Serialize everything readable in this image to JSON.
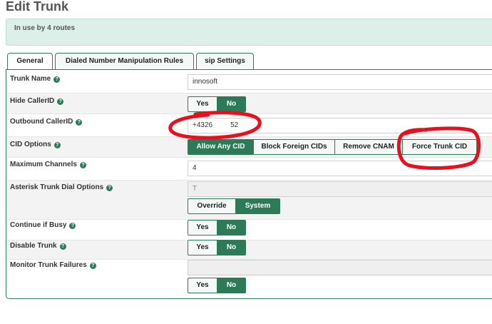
{
  "page_title": "Edit Trunk",
  "info_text": "In use by 4 routes",
  "tabs": [
    {
      "label": "General",
      "active": true
    },
    {
      "label": "Dialed Number Manipulation Rules",
      "active": false
    },
    {
      "label": "sip Settings",
      "active": false
    }
  ],
  "help_glyph": "?",
  "fields": {
    "trunk_name": {
      "label": "Trunk Name",
      "value": "innosoft"
    },
    "hide_callerid": {
      "label": "Hide CallerID",
      "options": [
        "Yes",
        "No"
      ],
      "selected": "No"
    },
    "outbound_callerid": {
      "label": "Outbound CallerID",
      "value": "+4326         52"
    },
    "cid_options": {
      "label": "CID Options",
      "options": [
        "Allow Any CID",
        "Block Foreign CIDs",
        "Remove CNAM",
        "Force Trunk CID"
      ],
      "selected": "Allow Any CID"
    },
    "maximum_channels": {
      "label": "Maximum Channels",
      "value": "4"
    },
    "asterisk_dial_options": {
      "label": "Asterisk Trunk Dial Options",
      "value": "T",
      "options": [
        "Override",
        "System"
      ],
      "selected": "System"
    },
    "continue_if_busy": {
      "label": "Continue if Busy",
      "options": [
        "Yes",
        "No"
      ],
      "selected": "No"
    },
    "disable_trunk": {
      "label": "Disable Trunk",
      "options": [
        "Yes",
        "No"
      ],
      "selected": "No"
    },
    "monitor_trunk_failures": {
      "label": "Monitor Trunk Failures",
      "value": "",
      "options": [
        "Yes",
        "No"
      ],
      "selected": "No"
    }
  },
  "colors": {
    "accent": "#2d7a58",
    "annotation": "#e8101e",
    "info_bg": "#dcefe9"
  }
}
